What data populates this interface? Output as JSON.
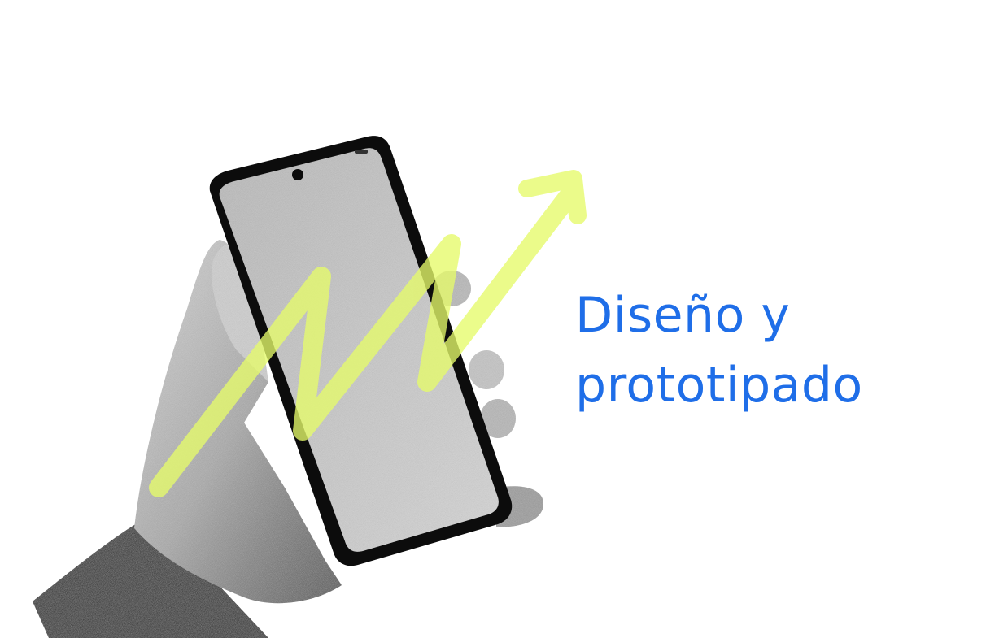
{
  "headline": {
    "line1": "Diseño y",
    "line2": "prototipado"
  },
  "illustration": {
    "subject": "hand-holding-phone",
    "arrow_color": "#e6fb6a",
    "text_color": "#1f6ee8"
  }
}
